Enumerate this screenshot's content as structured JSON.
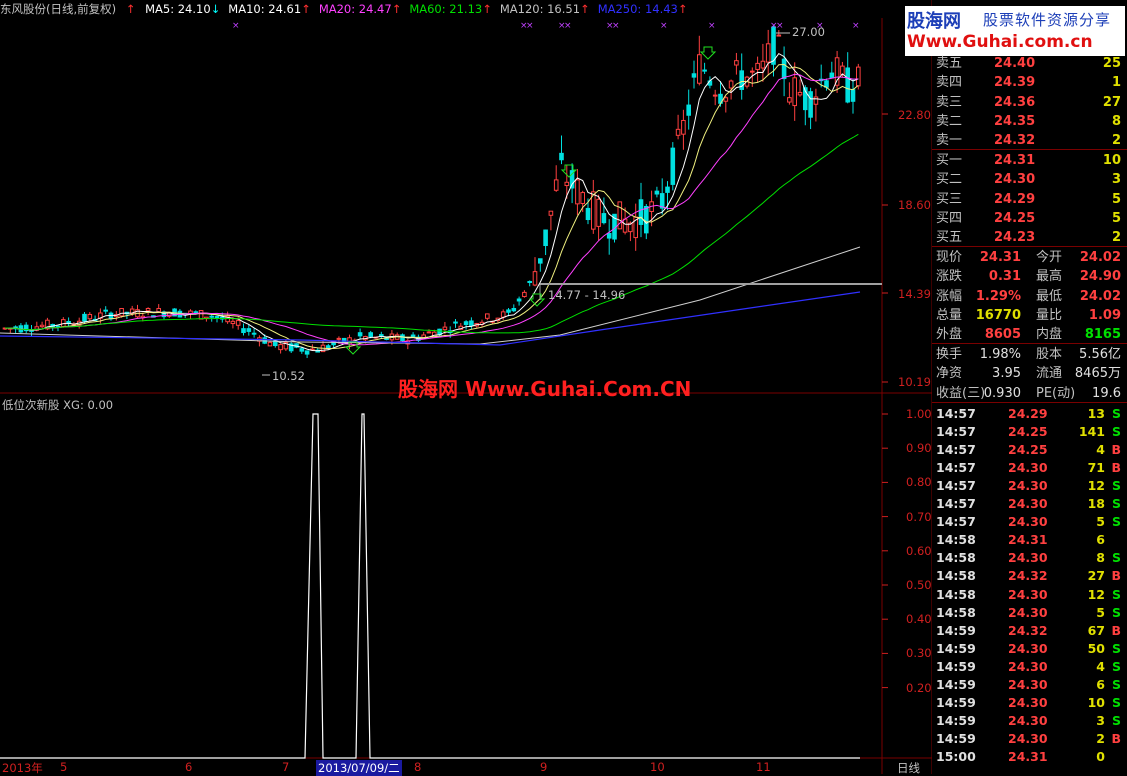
{
  "header": {
    "stock_title": "东风股份(日线,前复权)",
    "ma": [
      {
        "label": "MA5: 24.10",
        "color": "#ffffff",
        "arrow": "↓",
        "arrow_color": "#00ffff"
      },
      {
        "label": "MA10: 24.61",
        "color": "#ffffff",
        "arrow": "↑",
        "arrow_color": "#ff3030"
      },
      {
        "label": "MA20: 24.47",
        "color": "#ff40ff",
        "arrow": "↑",
        "arrow_color": "#ff3030"
      },
      {
        "label": "MA60: 21.13",
        "color": "#00e000",
        "arrow": "↑",
        "arrow_color": "#ff3030"
      },
      {
        "label": "MA120: 16.51",
        "color": "#c0c0c0",
        "arrow": "↑",
        "arrow_color": "#ff3030"
      },
      {
        "label": "MA250: 14.43",
        "color": "#3030ff",
        "arrow": "↑",
        "arrow_color": "#ff3030"
      }
    ],
    "price_up_icon": "red-up-arrow"
  },
  "price_axis": [
    "22.80",
    "18.60",
    "14.39",
    "10.19"
  ],
  "indicator": {
    "title": "低位次新股  XG: 0.00",
    "axis": [
      "1.00",
      "0.90",
      "0.80",
      "0.70",
      "0.60",
      "0.50",
      "0.40",
      "0.30",
      "0.20"
    ]
  },
  "annotations": {
    "high": "27.00",
    "low": "10.52",
    "range": "14.77 - 14.96"
  },
  "x_axis": {
    "labels": [
      "2013年",
      "5",
      "6",
      "7",
      "8",
      "9",
      "10",
      "11"
    ],
    "selected": "2013/07/09/二",
    "period": "日线"
  },
  "watermark": "股海网 Www.Guhai.Com.CN",
  "logo": {
    "line1": "股海网",
    "line1b": "股票软件资源分享",
    "line2": "Www.Guhai.com.cn"
  },
  "order_book": {
    "sell": [
      {
        "label": "卖五",
        "price": "24.40",
        "vol": "25"
      },
      {
        "label": "卖四",
        "price": "24.39",
        "vol": "1"
      },
      {
        "label": "卖三",
        "price": "24.36",
        "vol": "27"
      },
      {
        "label": "卖二",
        "price": "24.35",
        "vol": "8"
      },
      {
        "label": "卖一",
        "price": "24.32",
        "vol": "2"
      }
    ],
    "buy": [
      {
        "label": "买一",
        "price": "24.31",
        "vol": "10"
      },
      {
        "label": "买二",
        "price": "24.30",
        "vol": "3"
      },
      {
        "label": "买三",
        "price": "24.29",
        "vol": "5"
      },
      {
        "label": "买四",
        "price": "24.25",
        "vol": "5"
      },
      {
        "label": "买五",
        "price": "24.23",
        "vol": "2"
      }
    ]
  },
  "stats": [
    {
      "l1": "现价",
      "v1": "24.31",
      "c1": "#ff4040",
      "l2": "今开",
      "v2": "24.02",
      "c2": "#ff4040"
    },
    {
      "l1": "涨跌",
      "v1": "0.31",
      "c1": "#ff4040",
      "l2": "最高",
      "v2": "24.90",
      "c2": "#ff4040"
    },
    {
      "l1": "涨幅",
      "v1": "1.29%",
      "c1": "#ff4040",
      "l2": "最低",
      "v2": "24.02",
      "c2": "#ff4040"
    },
    {
      "l1": "总量",
      "v1": "16770",
      "c1": "#e0e000",
      "l2": "量比",
      "v2": "1.09",
      "c2": "#ff4040"
    },
    {
      "l1": "外盘",
      "v1": "8605",
      "c1": "#ff4040",
      "l2": "内盘",
      "v2": "8165",
      "c2": "#00e000"
    }
  ],
  "stats2": [
    {
      "l1": "换手",
      "v1": "1.98%",
      "l2": "股本",
      "v2": "5.56亿"
    },
    {
      "l1": "净资",
      "v1": "3.95",
      "l2": "流通",
      "v2": "8465万"
    },
    {
      "l1": "收益(三)",
      "v1": "0.930",
      "l2": "PE(动)",
      "v2": "19.6"
    }
  ],
  "ticks": [
    {
      "t": "14:57",
      "p": "24.29",
      "v": "13",
      "d": "S"
    },
    {
      "t": "14:57",
      "p": "24.25",
      "v": "141",
      "d": "S"
    },
    {
      "t": "14:57",
      "p": "24.25",
      "v": "4",
      "d": "B"
    },
    {
      "t": "14:57",
      "p": "24.30",
      "v": "71",
      "d": "B"
    },
    {
      "t": "14:57",
      "p": "24.30",
      "v": "12",
      "d": "S"
    },
    {
      "t": "14:57",
      "p": "24.30",
      "v": "18",
      "d": "S"
    },
    {
      "t": "14:57",
      "p": "24.30",
      "v": "5",
      "d": "S"
    },
    {
      "t": "14:58",
      "p": "24.31",
      "v": "6",
      "d": ""
    },
    {
      "t": "14:58",
      "p": "24.30",
      "v": "8",
      "d": "S"
    },
    {
      "t": "14:58",
      "p": "24.32",
      "v": "27",
      "d": "B"
    },
    {
      "t": "14:58",
      "p": "24.30",
      "v": "12",
      "d": "S"
    },
    {
      "t": "14:58",
      "p": "24.30",
      "v": "5",
      "d": "S"
    },
    {
      "t": "14:59",
      "p": "24.32",
      "v": "67",
      "d": "B"
    },
    {
      "t": "14:59",
      "p": "24.30",
      "v": "50",
      "d": "S"
    },
    {
      "t": "14:59",
      "p": "24.30",
      "v": "4",
      "d": "S"
    },
    {
      "t": "14:59",
      "p": "24.30",
      "v": "6",
      "d": "S"
    },
    {
      "t": "14:59",
      "p": "24.30",
      "v": "10",
      "d": "S"
    },
    {
      "t": "14:59",
      "p": "24.30",
      "v": "3",
      "d": "S"
    },
    {
      "t": "14:59",
      "p": "24.30",
      "v": "2",
      "d": "B"
    },
    {
      "t": "15:00",
      "p": "24.31",
      "v": "0",
      "d": ""
    }
  ],
  "colors": {
    "up": "#ff4040",
    "down": "#00e0e0",
    "buy_dir": "#ff4040",
    "sell_dir": "#00e000"
  }
}
